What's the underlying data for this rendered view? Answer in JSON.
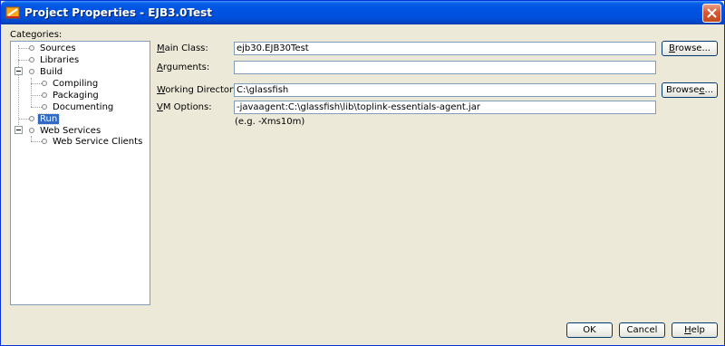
{
  "window": {
    "title": "Project Properties - EJB3.0Test",
    "close_label": "×"
  },
  "categories": {
    "label": "Categories:",
    "items": [
      {
        "label": "Sources"
      },
      {
        "label": "Libraries"
      },
      {
        "label": "Build",
        "expanded": true
      },
      {
        "label": "Compiling"
      },
      {
        "label": "Packaging"
      },
      {
        "label": "Documenting"
      },
      {
        "label": "Run",
        "selected": true
      },
      {
        "label": "Web Services",
        "expanded": true
      },
      {
        "label": "Web Service Clients"
      }
    ]
  },
  "form": {
    "main_class": {
      "label_u": "M",
      "label_rest": "ain Class:",
      "value": "ejb30.EJB30Test",
      "browse_label_pre": "",
      "browse_label_u": "B",
      "browse_label_rest": "rowse..."
    },
    "arguments": {
      "label_u": "A",
      "label_rest": "rguments:",
      "value": ""
    },
    "working_directory": {
      "label_u": "W",
      "label_rest": "orking Directory:",
      "value": "C:\\glassfish",
      "browse_label_pre": "Browse",
      "browse_label_u": "e",
      "browse_label_rest": "..."
    },
    "vm_options": {
      "label_u": "V",
      "label_rest": "M Options:",
      "value": "-javaagent:C:\\glassfish\\lib\\toplink-essentials-agent.jar",
      "hint": "(e.g. -Xms10m)"
    }
  },
  "buttons": {
    "ok": "OK",
    "cancel": "Cancel",
    "help_u": "H",
    "help_rest": "elp"
  },
  "colors": {
    "titlebar": "#0054e3",
    "selection": "#316ac5",
    "dialog_bg": "#ece9d8"
  }
}
